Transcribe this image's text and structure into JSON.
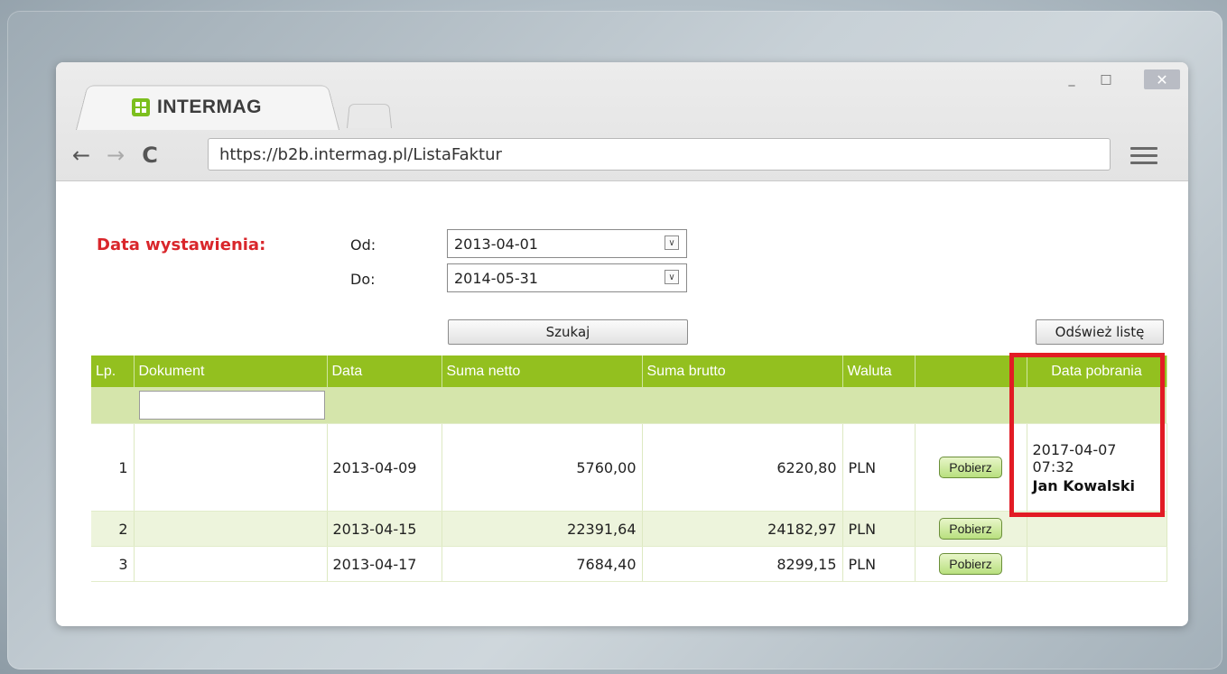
{
  "tab": {
    "title": "INTERMAG"
  },
  "window": {
    "minimize": "_",
    "maximize": "□",
    "close": "✕"
  },
  "address_bar": {
    "url": "https://b2b.intermag.pl/ListaFaktur"
  },
  "filters": {
    "date_label": "Data wystawienia:",
    "from_label": "Od:",
    "from_value": "2013-04-01",
    "to_label": "Do:",
    "to_value": "2014-05-31"
  },
  "buttons": {
    "search": "Szukaj",
    "refresh": "Odśwież listę"
  },
  "table": {
    "headers": [
      "Lp.",
      "Dokument",
      "Data",
      "Suma netto",
      "Suma brutto",
      "Waluta",
      "",
      "Data pobrania"
    ],
    "rows": [
      {
        "lp": "1",
        "document": "",
        "date": "2013-04-09",
        "net": "5760,00",
        "gross": "6220,80",
        "currency": "PLN",
        "action": "Pobierz",
        "download_date": "2017-04-07 07:32",
        "download_user": "Jan Kowalski"
      },
      {
        "lp": "2",
        "document": "",
        "date": "2013-04-15",
        "net": "22391,64",
        "gross": "24182,97",
        "currency": "PLN",
        "action": "Pobierz",
        "download_date": "",
        "download_user": ""
      },
      {
        "lp": "3",
        "document": "",
        "date": "2013-04-17",
        "net": "7684,40",
        "gross": "8299,15",
        "currency": "PLN",
        "action": "Pobierz",
        "download_date": "",
        "download_user": ""
      }
    ]
  },
  "colors": {
    "accent_green": "#93c01f",
    "highlight_red": "#e21b24",
    "label_red": "#d9262b"
  },
  "icons": [
    "back-arrow-icon",
    "forward-arrow-icon",
    "reload-icon",
    "menu-icon",
    "intermag-logo-icon",
    "dropdown-arrow-icon"
  ]
}
